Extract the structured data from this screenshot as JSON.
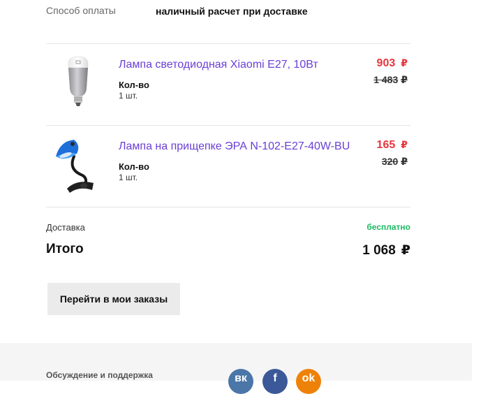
{
  "payment": {
    "label": "Способ оплаты",
    "value": "наличный расчет при доставке"
  },
  "products": [
    {
      "name": "Лампа светодиодная Xiaomi E27, 10Вт",
      "qty_label": "Кол-во",
      "qty_value": "1 шт.",
      "price": "903",
      "old_price": "1 483",
      "image_icon": "led-bulb"
    },
    {
      "name": "Лампа на прищепке ЭРА N-102-E27-40W-BU",
      "qty_label": "Кол-во",
      "qty_value": "1 шт.",
      "price": "165",
      "old_price": "320",
      "image_icon": "clip-desk-lamp"
    }
  ],
  "currency_symbol": "₽",
  "summary": {
    "delivery_label": "Доставка",
    "delivery_value": "бесплатно",
    "total_label": "Итого",
    "total_value": "1 068"
  },
  "actions": {
    "orders_button": "Перейти в мои заказы"
  },
  "footer": {
    "support_title": "Обсуждение и поддержка",
    "social": [
      {
        "name": "vk",
        "glyph": "вк",
        "color": "#4a76a8"
      },
      {
        "name": "facebook",
        "glyph": "f",
        "color": "#3b5998"
      },
      {
        "name": "odnoklassniki",
        "glyph": "ok",
        "color": "#ee8208"
      }
    ]
  },
  "colors": {
    "link": "#6a3fd6",
    "price": "#e8343c",
    "free": "#1dbb62",
    "button_bg": "#ebebeb",
    "footer_bg": "#f5f5f5"
  }
}
